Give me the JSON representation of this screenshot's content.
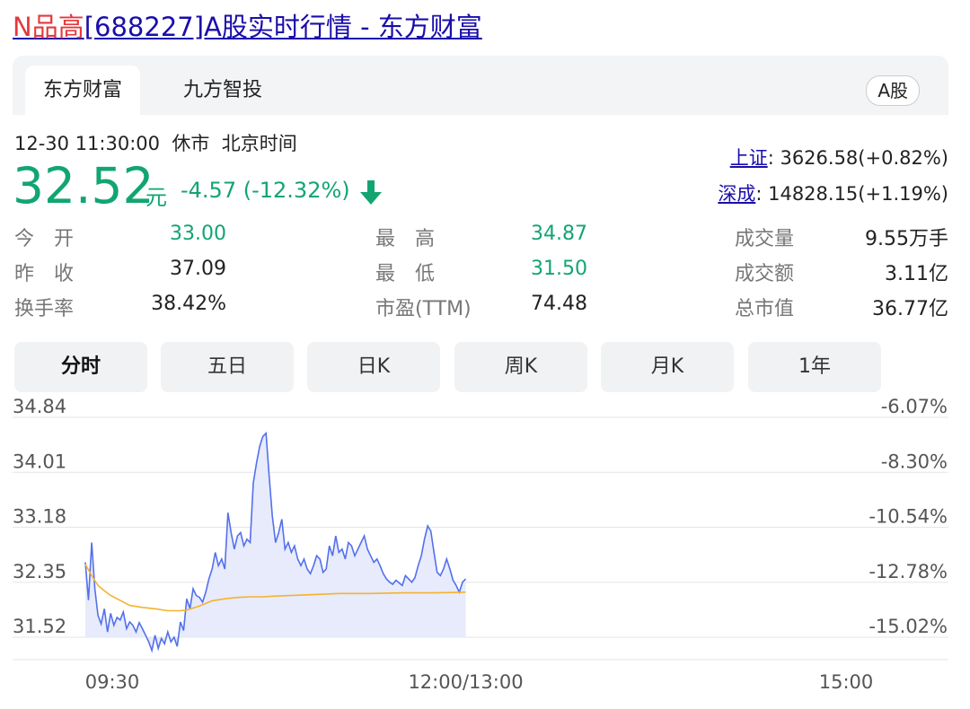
{
  "page": {
    "title_highlight": "N品高",
    "title_rest": "[688227]A股实时行情 - 东方财富"
  },
  "tabs": [
    {
      "label": "东方财富",
      "active": true
    },
    {
      "label": "九方智投",
      "active": false
    }
  ],
  "market_badge": "A股",
  "status": {
    "time": "12-30 11:30:00",
    "state": "休市",
    "timezone": "北京时间"
  },
  "quote": {
    "price": "32.52",
    "unit": "元",
    "change": "-4.57 (-12.32%)",
    "direction": "down",
    "color_down": "#12a571"
  },
  "indices": [
    {
      "name": "上证",
      "value": ": 3626.58(+0.82%)"
    },
    {
      "name": "深成",
      "value": ": 14828.15(+1.19%)"
    }
  ],
  "stats": [
    {
      "label": "今　开",
      "value": "33.00",
      "color": "green"
    },
    {
      "label": "最　高",
      "value": "34.87",
      "color": "green"
    },
    {
      "label": "成交量",
      "value": "9.55万手",
      "color": "normal"
    },
    {
      "label": "昨　收",
      "value": "37.09",
      "color": "normal"
    },
    {
      "label": "最　低",
      "value": "31.50",
      "color": "green"
    },
    {
      "label": "成交额",
      "value": "3.11亿",
      "color": "normal"
    },
    {
      "label": "换手率",
      "value": "38.42%",
      "color": "normal"
    },
    {
      "label": "市盈(TTM)",
      "value": "74.48",
      "color": "normal"
    },
    {
      "label": "总市值",
      "value": "36.77亿",
      "color": "normal"
    }
  ],
  "periods": [
    {
      "label": "分时",
      "active": true
    },
    {
      "label": "五日",
      "active": false
    },
    {
      "label": "日K",
      "active": false
    },
    {
      "label": "周K",
      "active": false
    },
    {
      "label": "月K",
      "active": false
    },
    {
      "label": "1年",
      "active": false
    }
  ],
  "chart_data": {
    "type": "line",
    "y_left_ticks": [
      "34.84",
      "34.01",
      "33.18",
      "32.35",
      "31.52"
    ],
    "y_right_ticks": [
      "-6.07%",
      "-8.30%",
      "-10.54%",
      "-12.78%",
      "-15.02%"
    ],
    "x_ticks": [
      "09:30",
      "12:00/13:00",
      "15:00"
    ],
    "ylim": [
      31.52,
      34.84
    ],
    "session_minutes": 240,
    "price_color": "#5470ec",
    "avg_color": "#f5b22e",
    "series": [
      {
        "role": "price",
        "x": [
          0,
          1,
          2,
          3,
          4,
          5,
          6,
          7,
          8,
          9,
          10,
          11,
          12,
          13,
          14,
          15,
          16,
          17,
          18,
          19,
          20,
          21,
          22,
          23,
          24,
          25,
          26,
          27,
          28,
          29,
          30,
          31,
          32,
          33,
          34,
          35,
          36,
          37,
          38,
          39,
          40,
          41,
          42,
          43,
          44,
          45,
          46,
          47,
          48,
          49,
          50,
          51,
          52,
          53,
          54,
          55,
          56,
          57,
          58,
          59,
          60,
          61,
          62,
          63,
          64,
          65,
          66,
          67,
          68,
          69,
          70,
          71,
          72,
          73,
          74,
          75,
          76,
          77,
          78,
          79,
          80,
          81,
          82,
          83,
          84,
          85,
          86,
          87,
          88,
          89,
          90,
          91,
          92,
          93,
          94,
          95,
          96,
          97,
          98,
          99,
          100,
          101,
          102,
          103,
          104,
          105,
          106,
          107,
          108,
          109,
          110,
          111,
          112,
          113,
          114,
          115,
          116,
          117,
          118,
          119,
          120
        ],
        "values": [
          32.65,
          32.08,
          32.95,
          32.25,
          31.85,
          31.72,
          31.95,
          31.6,
          31.88,
          31.7,
          31.82,
          31.78,
          31.9,
          31.65,
          31.75,
          31.7,
          31.6,
          31.74,
          31.65,
          31.55,
          31.45,
          31.32,
          31.55,
          31.35,
          31.5,
          31.42,
          31.6,
          31.45,
          31.52,
          31.38,
          31.75,
          31.62,
          32.1,
          31.95,
          32.25,
          32.15,
          32.12,
          32.05,
          32.2,
          32.4,
          32.55,
          32.8,
          32.6,
          32.7,
          32.55,
          33.4,
          33.1,
          32.85,
          33.05,
          33.1,
          32.9,
          33.0,
          32.95,
          33.85,
          34.15,
          34.4,
          34.55,
          34.6,
          33.95,
          33.35,
          32.95,
          33.1,
          33.3,
          32.85,
          32.95,
          32.8,
          32.9,
          32.7,
          32.6,
          32.7,
          32.55,
          32.48,
          32.6,
          32.75,
          32.7,
          32.5,
          32.55,
          32.9,
          32.75,
          33.05,
          32.8,
          32.85,
          32.7,
          32.95,
          32.9,
          32.75,
          32.85,
          32.95,
          33.05,
          32.85,
          32.75,
          32.65,
          32.7,
          32.6,
          32.48,
          32.4,
          32.35,
          32.32,
          32.38,
          32.34,
          32.3,
          32.45,
          32.4,
          32.35,
          32.42,
          32.6,
          32.75,
          33.0,
          33.2,
          33.12,
          32.8,
          32.5,
          32.45,
          32.55,
          32.7,
          32.55,
          32.38,
          32.3,
          32.2,
          32.35,
          32.4
        ]
      },
      {
        "role": "average",
        "x": [
          0,
          2,
          4,
          6,
          8,
          10,
          14,
          18,
          22,
          26,
          30,
          32,
          34,
          36,
          38,
          40,
          44,
          48,
          52,
          56,
          60,
          70,
          80,
          90,
          100,
          110,
          120
        ],
        "values": [
          32.62,
          32.45,
          32.3,
          32.22,
          32.15,
          32.1,
          32.0,
          31.97,
          31.95,
          31.92,
          31.92,
          31.93,
          31.96,
          31.99,
          32.03,
          32.07,
          32.1,
          32.12,
          32.13,
          32.13,
          32.14,
          32.16,
          32.18,
          32.18,
          32.19,
          32.19,
          32.2
        ]
      }
    ]
  }
}
